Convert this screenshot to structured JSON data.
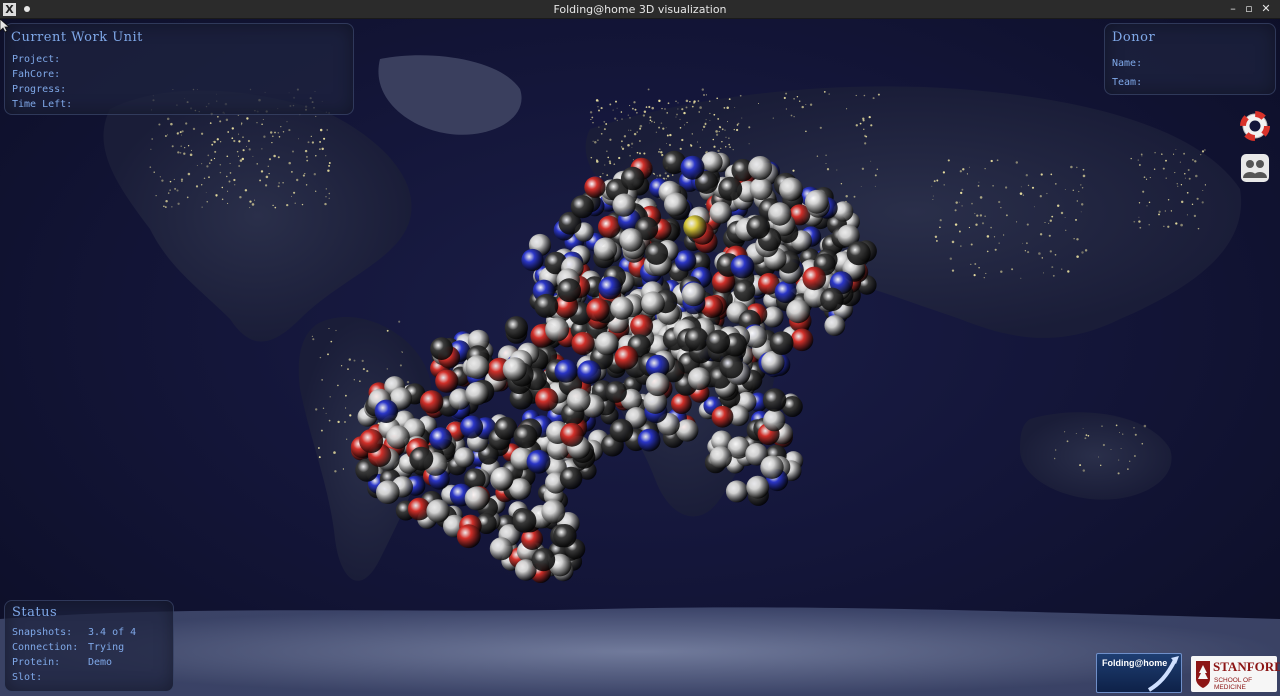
{
  "window": {
    "title": "Folding@home 3D visualization",
    "app_icon": "X",
    "buttons": {
      "minimize": "–",
      "maximize": "▫",
      "close": "✕"
    }
  },
  "work_unit": {
    "title": "Current Work Unit",
    "rows": [
      {
        "label": "Project:",
        "value": ""
      },
      {
        "label": "FahCore:",
        "value": ""
      },
      {
        "label": "Progress:",
        "value": ""
      },
      {
        "label": "Time Left:",
        "value": ""
      }
    ]
  },
  "donor": {
    "title": "Donor",
    "rows": [
      {
        "label": "Name:",
        "value": ""
      },
      {
        "label": "Team:",
        "value": ""
      }
    ]
  },
  "status": {
    "title": "Status",
    "rows": [
      {
        "label": "Snapshots:",
        "value": "3.4 of 4"
      },
      {
        "label": "Connection:",
        "value": "Trying"
      },
      {
        "label": "Protein:",
        "value": "Demo"
      },
      {
        "label": "Slot:",
        "value": ""
      }
    ]
  },
  "icons": {
    "help": "lifebuoy-icon",
    "team": "team-icon"
  },
  "logos": {
    "fah": "Folding@home",
    "stanford_name": "STANFORD",
    "stanford_sub": "SCHOOL OF MEDICINE"
  },
  "colors": {
    "panel_text": "#7fa8e8",
    "carbon": "#3a3a3a",
    "hydrogen": "#d0d0d0",
    "oxygen": "#d2302a",
    "nitrogen": "#2b36c8",
    "sulfur": "#d8c83a"
  }
}
